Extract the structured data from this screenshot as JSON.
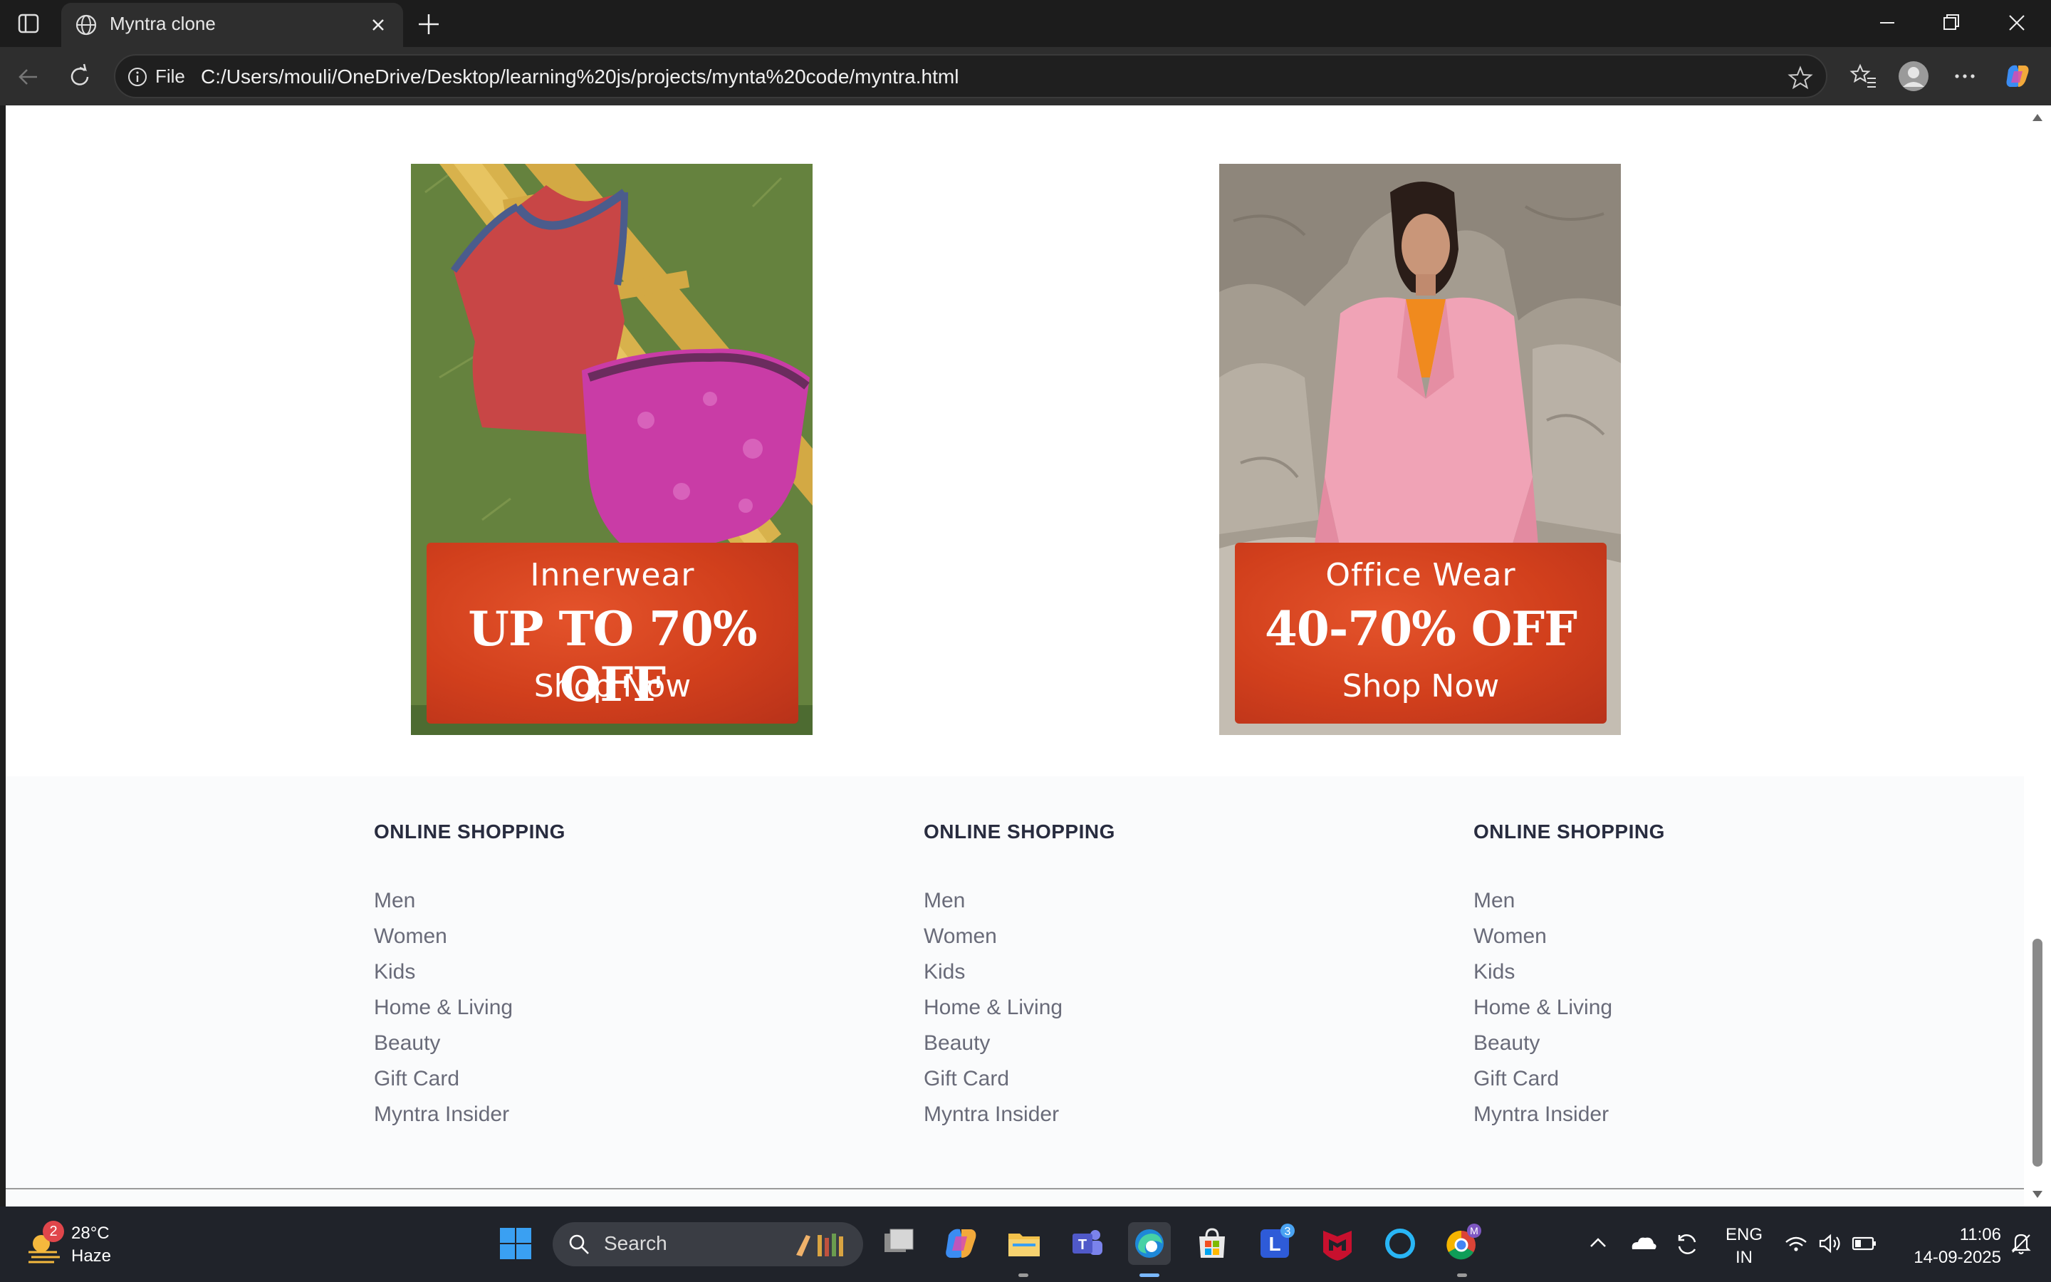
{
  "browser": {
    "tab_title": "Myntra clone",
    "address_prefix": "File",
    "url": "C:/Users/mouli/OneDrive/Desktop/learning%20js/projects/mynta%20code/myntra.html"
  },
  "banners": [
    {
      "category": "Innerwear",
      "offer": "UP TO 70% OFF",
      "cta": "Shop Now"
    },
    {
      "category": "Office Wear",
      "offer": "40-70% OFF",
      "cta": "Shop Now"
    }
  ],
  "footer": {
    "columns": [
      {
        "heading": "ONLINE SHOPPING",
        "links": [
          "Men",
          "Women",
          "Kids",
          "Home & Living",
          "Beauty",
          "Gift Card",
          "Myntra Insider"
        ]
      },
      {
        "heading": "ONLINE SHOPPING",
        "links": [
          "Men",
          "Women",
          "Kids",
          "Home & Living",
          "Beauty",
          "Gift Card",
          "Myntra Insider"
        ]
      },
      {
        "heading": "ONLINE SHOPPING",
        "links": [
          "Men",
          "Women",
          "Kids",
          "Home & Living",
          "Beauty",
          "Gift Card",
          "Myntra Insider"
        ]
      }
    ]
  },
  "taskbar": {
    "weather_badge": "2",
    "temperature": "28°C",
    "condition": "Haze",
    "search_label": "Search",
    "teams_badge": "3",
    "chrome_badge": "M",
    "language": "ENG",
    "region": "IN",
    "time": "11:06",
    "date": "14-09-2025"
  },
  "colors": {
    "promo_orange": "#d13f1c",
    "footer_heading": "#282c3f",
    "footer_link": "#696b79",
    "footer_bg": "#fafbfc"
  }
}
